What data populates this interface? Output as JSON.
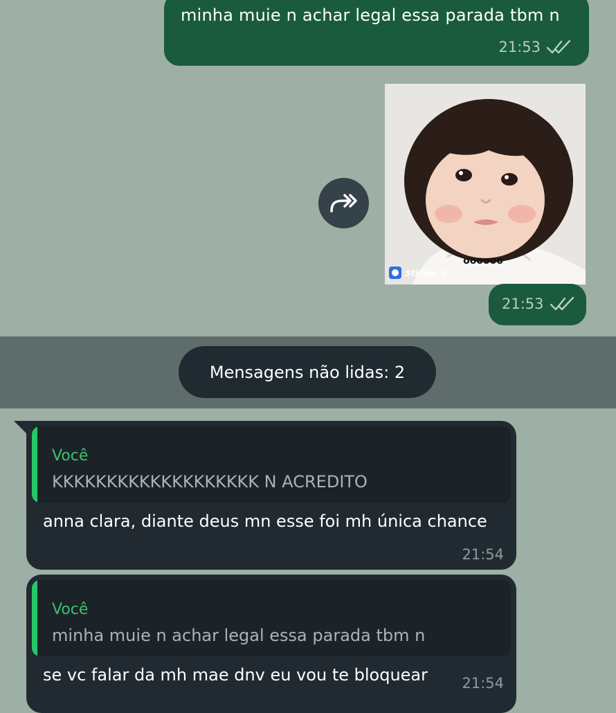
{
  "messages": {
    "out1": {
      "text": "minha muie n achar legal essa parada tbm n",
      "time": "21:53"
    },
    "sticker": {
      "time": "21:53",
      "watermark": "Sticker.ly",
      "caption": "oooooo"
    },
    "unread_label": "Mensagens não lidas: 2",
    "in1": {
      "reply_author": "Você",
      "reply_text": "KKKKKKKKKKKKKKKKKKK N ACREDITO",
      "text": "anna clara, diante deus mn esse foi mh única chance",
      "time": "21:54"
    },
    "in2": {
      "reply_author": "Você",
      "reply_text": "minha muie n achar legal essa parada tbm n",
      "text": "se vc falar da mh mae dnv eu vou te bloquear",
      "time": "21:54"
    }
  },
  "colors": {
    "chat_background": "#9eafa6",
    "outgoing_bubble": "#195b3c",
    "incoming_bubble": "#212a31",
    "reply_accent": "#26c769"
  },
  "icons": {
    "forward": "forward-icon",
    "read_receipt": "double-check-icon"
  }
}
